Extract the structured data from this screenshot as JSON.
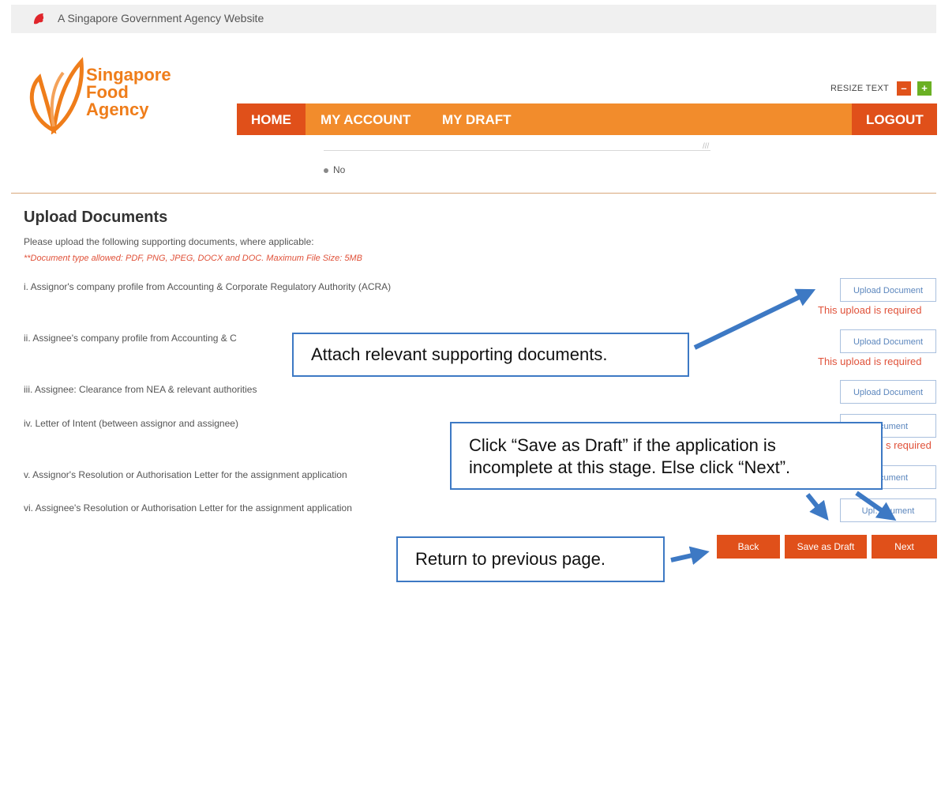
{
  "masthead": {
    "text": "A Singapore Government Agency Website"
  },
  "logo": {
    "line1": "Singapore",
    "line2": "Food",
    "line3": "Agency"
  },
  "resize": {
    "label": "RESIZE TEXT",
    "minus": "–",
    "plus": "+"
  },
  "nav": {
    "home": "HOME",
    "my_account": "MY ACCOUNT",
    "my_draft": "MY DRAFT",
    "logout": "LOGOUT"
  },
  "form_remnant": {
    "radio_no_label": "No"
  },
  "upload": {
    "title": "Upload Documents",
    "description": "Please upload the following supporting documents, where applicable:",
    "note": "**Document type allowed: PDF, PNG, JPEG, DOCX and DOC. Maximum File Size: 5MB",
    "documents": [
      {
        "label": "i. Assignor's company profile from Accounting & Corporate Regulatory Authority (ACRA)",
        "button": "Upload Document",
        "error": "This upload is required"
      },
      {
        "label": "ii. Assignee's company profile from Accounting & C",
        "button": "Upload Document",
        "error": "This upload is required"
      },
      {
        "label": "iii. Assignee: Clearance from NEA & relevant authorities",
        "button": "Upload Document",
        "error": ""
      },
      {
        "label": "iv. Letter of Intent (between assignor and assignee)",
        "button": "Document",
        "error": "s required"
      },
      {
        "label": "v. Assignor's Resolution or Authorisation Letter for the assignment application",
        "button": "Document",
        "error": ""
      },
      {
        "label": "vi. Assignee's Resolution or Authorisation Letter for the assignment application",
        "button": "Upl… cument",
        "error": ""
      }
    ]
  },
  "actions": {
    "back": "Back",
    "save_draft": "Save as Draft",
    "next": "Next"
  },
  "callouts": {
    "attach": "Attach relevant supporting documents.",
    "save_line1": "Click “Save as Draft” if the application is",
    "save_line2": "incomplete at this stage. Else click “Next”.",
    "return": "Return to previous page."
  },
  "colors": {
    "brand_orange": "#f28c2c",
    "brand_dark_orange": "#e0501a",
    "callout_blue": "#3d79c4",
    "error_red": "#e0523a"
  }
}
